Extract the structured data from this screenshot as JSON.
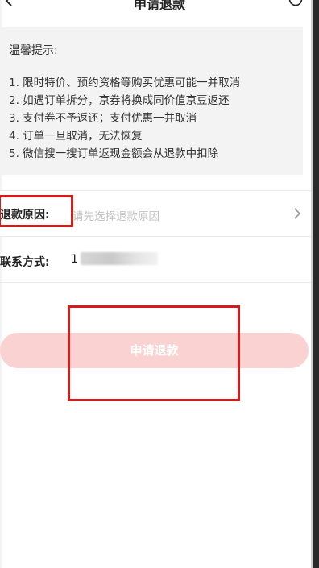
{
  "header": {
    "title": "申请退款",
    "back_icon": "back-arrow-icon",
    "help_icon": "help-circle-icon"
  },
  "tips": {
    "title": "温馨提示:",
    "items": [
      "1. 限时特价、预约资格等购买优惠可能一并取消",
      "2. 如遇订单拆分，京券将换成同价值京豆返还",
      "3. 支付券不予返还；支付优惠一并取消",
      "4. 订单一旦取消，无法恢复",
      "5. 微信搜一搜订单返现金额会从退款中扣除"
    ]
  },
  "refund_reason": {
    "label": "退款原因:",
    "placeholder": "请先选择退款原因",
    "chevron_icon": "chevron-right-icon"
  },
  "contact": {
    "label": "联系方式:",
    "value_visible": "1"
  },
  "submit": {
    "label": "申请退款"
  },
  "colors": {
    "button_bg": "#fbd2d2",
    "annotation_red": "#d61b1b",
    "tips_bg": "#f3f3f3",
    "placeholder": "#c2c2c2"
  }
}
